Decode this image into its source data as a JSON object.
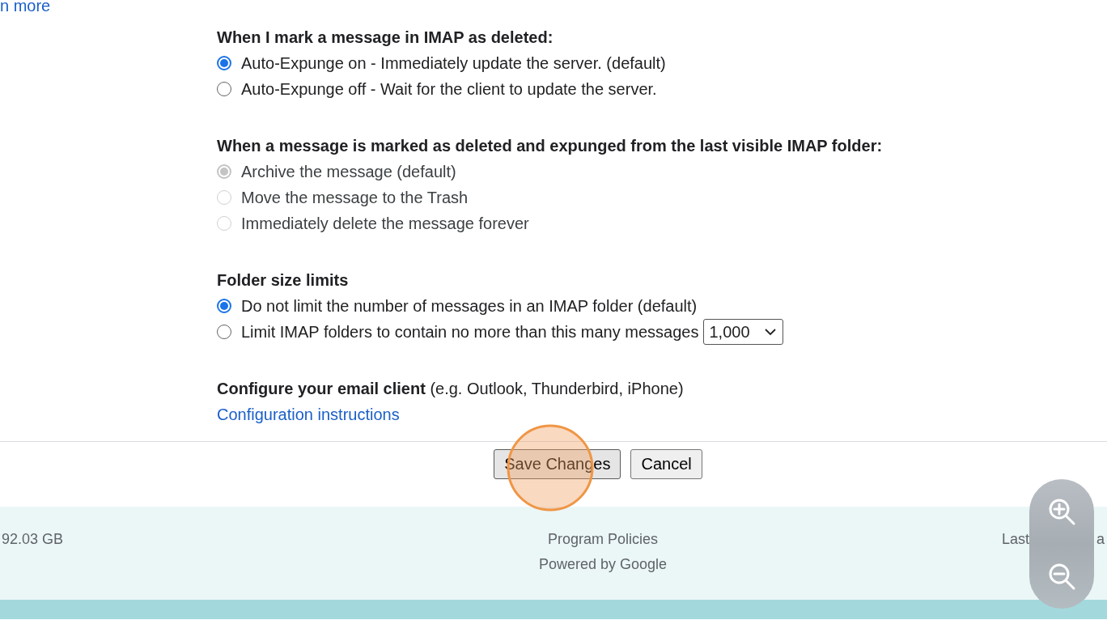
{
  "top_link": "n more",
  "sections": [
    {
      "heading": "When I mark a message in IMAP as deleted:",
      "options": [
        {
          "label": "Auto-Expunge on - Immediately update the server. (default)",
          "selected": true,
          "disabled": false
        },
        {
          "label": "Auto-Expunge off - Wait for the client to update the server.",
          "selected": false,
          "disabled": false
        }
      ]
    },
    {
      "heading": "When a message is marked as deleted and expunged from the last visible IMAP folder:",
      "options": [
        {
          "label": "Archive the message (default)",
          "selected": true,
          "disabled": true
        },
        {
          "label": "Move the message to the Trash",
          "selected": false,
          "disabled": true
        },
        {
          "label": "Immediately delete the message forever",
          "selected": false,
          "disabled": true
        }
      ]
    },
    {
      "heading": "Folder size limits",
      "options": [
        {
          "label": "Do not limit the number of messages in an IMAP folder (default)",
          "selected": true,
          "disabled": false
        },
        {
          "label": "Limit IMAP folders to contain no more than this many messages",
          "selected": false,
          "disabled": false,
          "select_value": "1,000"
        }
      ]
    }
  ],
  "configure": {
    "heading": "Configure your email client",
    "note": "(e.g. Outlook, Thunderbird, iPhone)",
    "link": "Configuration instructions"
  },
  "buttons": [
    "Save Changes",
    "Cancel"
  ],
  "footer": {
    "left": "92.03 GB",
    "center": [
      "Program Policies",
      "Powered by Google"
    ],
    "right": [
      "Last",
      "a"
    ]
  }
}
